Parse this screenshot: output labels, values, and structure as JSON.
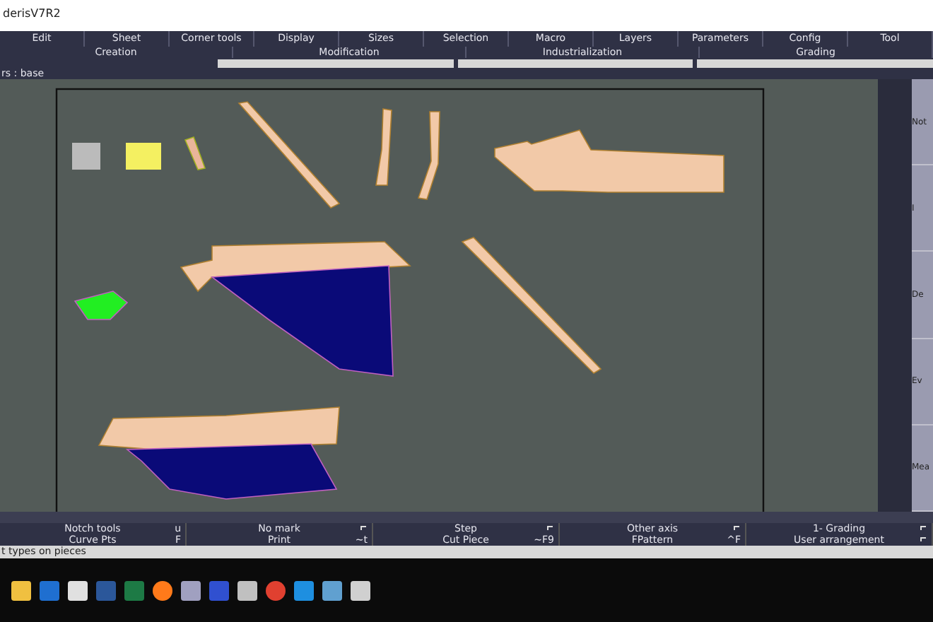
{
  "window": {
    "title": "derisV7R2"
  },
  "menu": [
    "Edit",
    "Sheet",
    "Corner tools",
    "Display",
    "Sizes",
    "Selection",
    "Macro",
    "Layers",
    "Parameters",
    "Config",
    "Tool"
  ],
  "tabs": [
    {
      "label": "Creation",
      "selected": false
    },
    {
      "label": "Modification",
      "selected": false
    },
    {
      "label": "Industrialization",
      "selected": false
    },
    {
      "label": "Grading",
      "selected": false
    }
  ],
  "path_label": "rs :  base",
  "right_panel": [
    "Not",
    "I",
    "De",
    "Ev",
    "Mea"
  ],
  "toolbar_rows": [
    [
      {
        "label": "Notch tools",
        "shortcut": "u"
      },
      {
        "label": "No mark"
      },
      {
        "label": "Step"
      },
      {
        "label": "Other axis"
      },
      {
        "label": "1- Grading"
      }
    ],
    [
      {
        "label": "Curve Pts",
        "shortcut": "F"
      },
      {
        "label": "Print",
        "shortcut": "~t"
      },
      {
        "label": "Cut Piece",
        "shortcut": "~F9"
      },
      {
        "label": "FPattern",
        "shortcut": "^F"
      },
      {
        "label": "User arrangement"
      }
    ]
  ],
  "status_bar": "t types on pieces"
}
